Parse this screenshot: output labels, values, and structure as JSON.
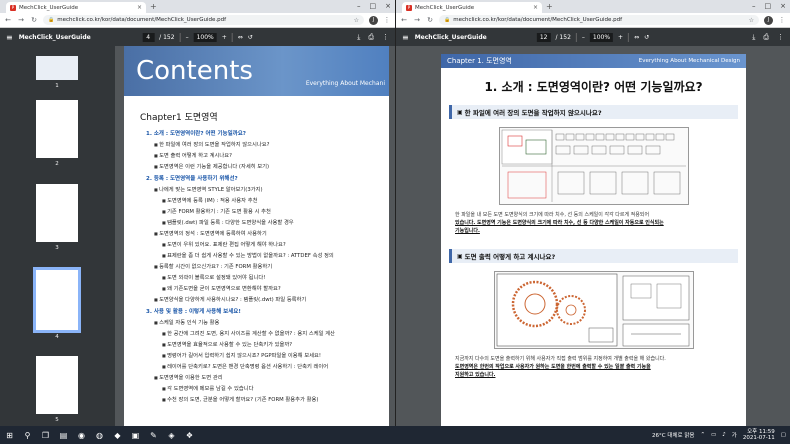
{
  "left": {
    "tab_title": "MechClick_UserGuide",
    "url": "mechclick.co.kr/kor/data/document/MechClick_UserGuide.pdf",
    "doc_name": "MechClick_UserGuide",
    "page_current": "4",
    "page_total": "/ 152",
    "zoom": "100%",
    "thumb_labels": [
      "1",
      "2",
      "3",
      "4",
      "5"
    ],
    "banner_title": "Contents",
    "banner_tag": "Everything About Mechani",
    "chapter": "Chapter1 도면영역",
    "sections": [
      {
        "title": "1. 소개 : 도면영역이란? 어떤 기능일까요?",
        "items": [
          "한 파일에 여러 장의 도면을 작업하지 않으시나요?",
          "도면 출력 어떻게 하고 계시나요?",
          "도면영역은 이런 기능을 제공합니다 (자세히 보기)"
        ]
      },
      {
        "title": "2. 등록 : 도면영역을 사용하기 위해선?",
        "items": [
          "나에게 맞는 도면영역 STYLE 알아보기(3가지)",
          "도면영역에 등록 (IM) : 적용 사용자 추천",
          "기존 FORM 활용하기 : 기존 도면 활용 시 추천",
          "템플릿(.dwt) 파일 등록 : 다양한 도면양식을 사용할 경우",
          "도면영역의 정석 : 도면영역에 등록하여 사용하기",
          "도면이 우위 있어요. 표제란 편집 어떻게 해야 하나요?",
          "표제란을 좀 더 쉽게 사용할 수 있는 방법이 없을까요? : ATTDEF 속성 정의",
          "등록할 시간이 없으신가요? : 기존 FORM 활용하기",
          "도면 외곽이 블록으로 설정돼 있어야 됩니다!",
          "왜 기존도면을 굳이 도면영역으로 변환해야 할까요?",
          "도면양식을 다양하게 사용하시나요? : 템플릿(.dwt) 파일 등록하기"
        ]
      },
      {
        "title": "3. 사용 및 활용 : 이렇게 사용해 보세요!",
        "items": [
          "스케일 자동 인식 기능 활용",
          "한 공간에 그려진 도면, 용지 사이즈를 계산할 수 없을까? : 용지 스케일 계산",
          "도면영역을 효율적으로 사용할 수 있는 단축키가 있을까?",
          "명령어가 길어서 입력하기 쉽지 않으시죠? PGP파일을 이용해 보세요!",
          "레이어를 단축키로? 도면은 밴경 단축명령 옵션 사용하기 : 단축키 레이어",
          "도면영역을 이용한 도면 관리",
          "각 도면영역에 메모를 남길 수 있습니다",
          "수천 장의 도면, 균분을 어떻게 할까요? (기존 FORM 활용추가 활용)"
        ]
      }
    ]
  },
  "right": {
    "tab_title": "MechClick_UserGuide",
    "url": "mechclick.co.kr/kor/data/document/MechClick_UserGuide.pdf",
    "doc_name": "MechClick_UserGuide",
    "page_current": "12",
    "page_total": "/ 152",
    "zoom": "100%",
    "chapter_tag": "Chapter 1. 도면영역",
    "chapter_tag_en": "Everything About Mechanical Design",
    "title": "1. 소개 : 도면영역이란? 어떤 기능일까요?",
    "q1": "한 파일에 여러 장의 도면을 작업하지 않으시나요?",
    "para1": "한 파일을 내 모든 도면 도면양식의 크기에 따라 치수, 선 등의 스케일이 각각 다르게 적용되어",
    "para1b": "있습니다. 도면영역 기능은 도면양식의 크기에 따라 치수, 선 등 다양한 스케일이 자동으로 인식되는",
    "para1c": "기능입니다.",
    "q2": "도면 출력 어떻게 하고 계시나요?",
    "para2": "지금까지 다수의 도면을 출력하기 위해 사용자가 직접 출력 범위를 지정하여 개별 출력을 해 왔습니다.",
    "para2b": "도면영역은 한번의 작업으로 사용자가 원하는 도면을 한번에 출력할 수 있는 일괄 출력 기능을",
    "para2c": "지원하고 있습니다."
  },
  "taskbar": {
    "weather": "26°C 대체로 맑음",
    "lang": "가",
    "time": "오후 11:59",
    "date": "2021-07-11"
  },
  "colors": {
    "accent": "#3f67a8",
    "pdf_toolbar": "#323639",
    "viewer_bg": "#525659"
  }
}
